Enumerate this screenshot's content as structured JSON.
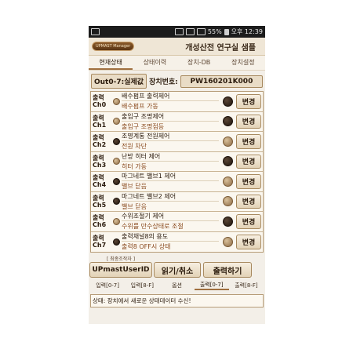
{
  "statusbar": {
    "battery": "55%",
    "time": "오후 12:39"
  },
  "app": {
    "logo": "UPMAST Manager",
    "title": "개성산전 연구실 샘플"
  },
  "tabs": [
    "현재상태",
    "상태이력",
    "장치-DB",
    "장치설정"
  ],
  "header": {
    "mode": "Out0-7:실제값",
    "device_label": "장치번호:",
    "device_id": "PW160201K000"
  },
  "rows": [
    {
      "ch": [
        "출력",
        "Ch0"
      ],
      "name": "배수펌프 출력제어",
      "state": "배수펌프 가동",
      "led_small": "light",
      "led_large": "dark",
      "button": "변경"
    },
    {
      "ch": [
        "출력",
        "Ch1"
      ],
      "name": "출입구 조명제어",
      "state": "출입구 조명점등",
      "led_small": "light",
      "led_large": "dark",
      "button": "변경"
    },
    {
      "ch": [
        "출력",
        "Ch2"
      ],
      "name": "조명계통 전원제어",
      "state": "전원 차단",
      "led_small": "dark",
      "led_large": "light",
      "button": "변경"
    },
    {
      "ch": [
        "출력",
        "Ch3"
      ],
      "name": "난방 히터 제어",
      "state": "히터 가동",
      "led_small": "light",
      "led_large": "dark",
      "button": "변경"
    },
    {
      "ch": [
        "출력",
        "Ch4"
      ],
      "name": "마그네트 밸브1 제어",
      "state": "밸브 닫음",
      "led_small": "dark",
      "led_large": "light",
      "button": "변경"
    },
    {
      "ch": [
        "출력",
        "Ch5"
      ],
      "name": "마그네트 밸브2 제어",
      "state": "밸브 닫음",
      "led_small": "dark",
      "led_large": "light",
      "button": "변경"
    },
    {
      "ch": [
        "출력",
        "Ch6"
      ],
      "name": "수위조절기 제어",
      "state": "수위를 만수상태로 조절",
      "led_small": "light",
      "led_large": "dark",
      "button": "변경"
    },
    {
      "ch": [
        "출력",
        "Ch7"
      ],
      "name": "출력채널8의 용도",
      "state": "출력8 OFF시 상태",
      "led_small": "dark",
      "led_large": "light",
      "button": "변경"
    }
  ],
  "controls": {
    "user_caption": "[ 최종조작자 ]",
    "user_id": "UPmastUserID",
    "read_cancel": "읽기/취소",
    "output": "출력하기"
  },
  "subtabs": [
    "입력[0-7]",
    "입력[8-F]",
    "옵션",
    "출력[0-7]",
    "출력[8-F]"
  ],
  "status": "상태: 장치에서 새로운 상태데이터 수신!"
}
